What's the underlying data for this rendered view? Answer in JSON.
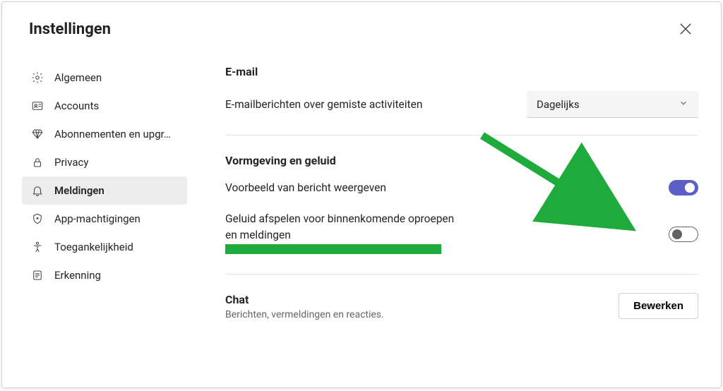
{
  "window": {
    "title": "Instellingen"
  },
  "sidebar": {
    "items": [
      {
        "label": "Algemeen"
      },
      {
        "label": "Accounts"
      },
      {
        "label": "Abonnementen en upgr…"
      },
      {
        "label": "Privacy"
      },
      {
        "label": "Meldingen"
      },
      {
        "label": "App-machtigingen"
      },
      {
        "label": "Toegankelijkheid"
      },
      {
        "label": "Erkenning"
      }
    ]
  },
  "content": {
    "email": {
      "heading": "E-mail",
      "missed_label": "E-mailberichten over gemiste activiteiten",
      "select_value": "Dagelijks"
    },
    "appearance": {
      "heading": "Vormgeving en geluid",
      "preview_label": "Voorbeeld van bericht weergeven",
      "sound_label": "Geluid afspelen voor binnenkomende oproepen en meldingen"
    },
    "chat": {
      "heading": "Chat",
      "sub": "Berichten, vermeldingen en reacties.",
      "edit_label": "Bewerken"
    }
  }
}
